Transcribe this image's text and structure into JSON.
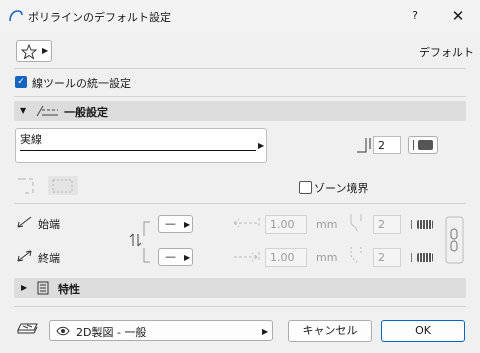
{
  "window": {
    "title": "ポリラインのデフォルト設定",
    "help_label": "?",
    "close_label": "✕"
  },
  "favorites": {
    "label": "デフォルト"
  },
  "unified_setting": {
    "label": "線ツールの統一設定",
    "checked": true
  },
  "general_section": {
    "title": "一般設定",
    "expanded": true
  },
  "line_type": {
    "name": "実線"
  },
  "pen": {
    "number": "2"
  },
  "zone_boundary": {
    "label": "ゾーン境界",
    "checked": false
  },
  "start": {
    "label": "始端",
    "marker": "—",
    "size": "1.00",
    "unit": "mm",
    "pen": "2"
  },
  "end": {
    "label": "終端",
    "marker": "—",
    "size": "1.00",
    "unit": "mm",
    "pen": "2"
  },
  "properties_section": {
    "title": "特性",
    "expanded": false
  },
  "layer": {
    "name": "2D製図 - 一般"
  },
  "buttons": {
    "cancel": "キャンセル",
    "ok": "OK"
  },
  "colors": {
    "accent": "#1565c0",
    "section_bar": "#dcdcdc",
    "ok_border": "#0067c0"
  }
}
